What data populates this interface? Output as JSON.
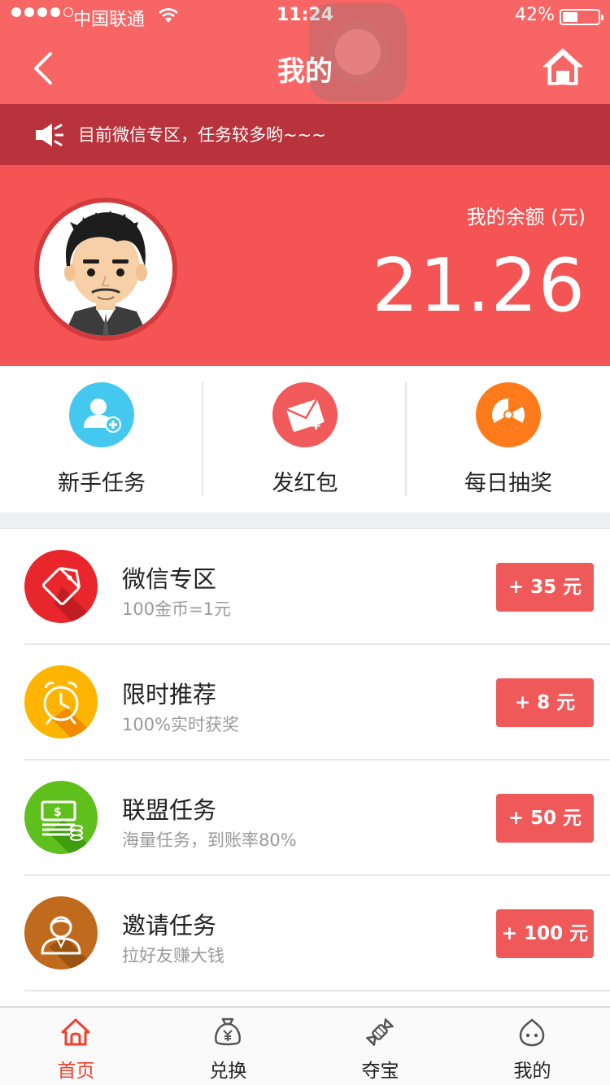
{
  "status_bar": {
    "carrier": "中国联通",
    "time": "11:24",
    "battery": "42%",
    "battery_level": 0.42,
    "signal_bars": 4
  },
  "nav": {
    "title": "我的",
    "back_icon": "chevron-left-icon",
    "home_icon": "home-icon"
  },
  "notice": {
    "icon": "megaphone-icon",
    "text": "目前微信专区，任务较多哟~~~"
  },
  "profile": {
    "balance_label": "我的余额 (元)",
    "balance": "21.26"
  },
  "quick_actions": [
    {
      "label": "新手任务",
      "icon": "add-user-icon",
      "color": "#45c8f0"
    },
    {
      "label": "发红包",
      "icon": "red-envelope-icon",
      "color": "#f05a5a"
    },
    {
      "label": "每日抽奖",
      "icon": "lottery-wheel-icon",
      "color": "#ff7a1a"
    }
  ],
  "tasks": [
    {
      "title": "微信专区",
      "subtitle": "100金币=1元",
      "reward": "+ 35 元",
      "icon": "tag-icon",
      "color": "#e8262c"
    },
    {
      "title": "限时推荐",
      "subtitle": "100%实时获奖",
      "reward": "+ 8 元",
      "icon": "alarm-clock-icon",
      "color": "#ffb400"
    },
    {
      "title": "联盟任务",
      "subtitle": "海量任务，到账率80%",
      "reward": "+ 50 元",
      "icon": "money-stack-icon",
      "color": "#5fbf1c"
    },
    {
      "title": "邀请任务",
      "subtitle": "拉好友赚大钱",
      "reward": "+ 100 元",
      "icon": "person-icon",
      "color": "#c06a1d"
    }
  ],
  "tabbar": [
    {
      "label": "首页",
      "icon": "home-icon",
      "active": true
    },
    {
      "label": "兑换",
      "icon": "money-bag-icon",
      "active": false
    },
    {
      "label": "夺宝",
      "icon": "candy-icon",
      "active": false
    },
    {
      "label": "我的",
      "icon": "smiley-icon",
      "active": false
    }
  ],
  "colors": {
    "primary": "#f76565",
    "notice_bg": "#b8333b",
    "header_bg": "#f55454",
    "reward_btn": "#f05959",
    "active_tab": "#f0402d"
  }
}
